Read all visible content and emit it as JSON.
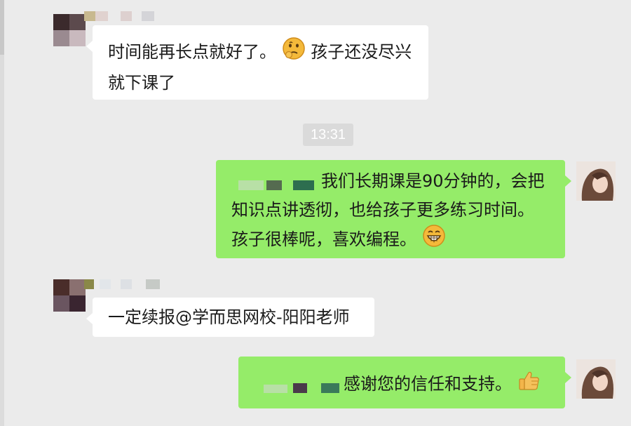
{
  "window": {
    "title": ""
  },
  "time_divider": "13:31",
  "messages": [
    {
      "side": "left",
      "sender": "redacted-parent",
      "lines": [
        "时间能再长点就好了。",
        "孩子还没尽兴",
        "就下课了"
      ],
      "emoji": "thinking-emoji"
    },
    {
      "side": "right",
      "sender": "redacted-teacher",
      "lines": [
        "我们长期课是90分钟的，会把",
        "知识点讲透彻，也给孩子更多练习时间。",
        "孩子很棒呢，喜欢编程。"
      ],
      "emoji": "grinning-emoji"
    },
    {
      "side": "left",
      "sender": "redacted-parent",
      "lines": [
        "一定续报@学而思网校-阳阳老师"
      ]
    },
    {
      "side": "right",
      "sender": "redacted-teacher",
      "lines": [
        "感谢您的信任和支持。"
      ],
      "emoji": "thumbs-up-emoji"
    }
  ],
  "colors": {
    "chat_background": "#ebebeb",
    "incoming_bubble": "#ffffff",
    "outgoing_bubble": "#95ec69",
    "timestamp_badge": "#dadada"
  }
}
